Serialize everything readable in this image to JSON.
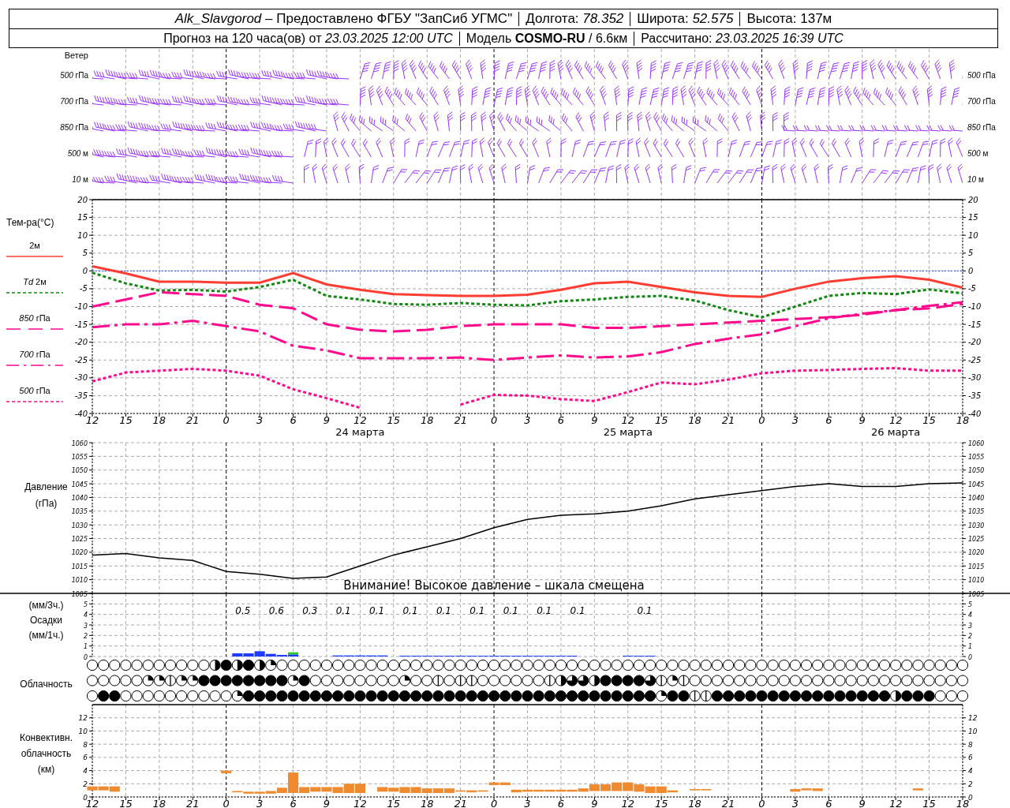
{
  "header": {
    "rows": [
      [
        "*Alk_Slavgorod* – Предоставлено ФГБУ \"ЗапСиб УГМС\"",
        "Долгота: *78.352*",
        "Широта: *52.575*",
        "Высота: 137м"
      ],
      [
        "Прогноз на 120 часа(ов) от *23.03.2025 12:00 UTC*",
        "Модель **COSMO-RU** / 6.6км",
        "Рассчитано: *23.03.2025 16:39 UTC*"
      ]
    ]
  },
  "wind": {
    "title": "Ветер",
    "left_labels": [
      "*500* гПа",
      "*700* гПа",
      "*850* гПа",
      "*500* м",
      "*10* м"
    ],
    "right_labels": [
      "*500* гПа",
      "*700* гПа",
      "*850* гПа",
      "*500* м",
      "*10* м"
    ]
  },
  "temperature": {
    "title": "Тем-ра(°C)",
    "day_labels": [
      "24 марта",
      "25 марта",
      "26 марта"
    ],
    "right_ticks": [
      "20",
      "15",
      "10",
      "5",
      "0",
      "-5",
      "-10",
      "-15",
      "-20",
      "-25",
      "-30",
      "-35",
      "-40"
    ],
    "chart_data": {
      "type": "line",
      "grid": true,
      "ref_lines": [
        {
          "axis": "y",
          "value": 0,
          "color": "#2244ff"
        }
      ],
      "categories": [
        "12",
        "15",
        "18",
        "21",
        "0",
        "3",
        "6",
        "9",
        "12",
        "15",
        "18",
        "21",
        "0",
        "3",
        "6",
        "9",
        "12",
        "15",
        "18",
        "21",
        "0",
        "3",
        "6",
        "9",
        "12",
        "15",
        "18"
      ],
      "ylim": [
        -40,
        20
      ],
      "yticks": [
        -40,
        -35,
        -30,
        -25,
        -20,
        -15,
        -10,
        -5,
        0,
        5,
        10,
        15,
        20
      ],
      "series": [
        {
          "name": "2м",
          "color": "#ff3c32",
          "line_style": "solid",
          "values": [
            1.3,
            -0.7,
            -3,
            -3,
            -3.3,
            -3.3,
            -0.6,
            -3.8,
            -5.3,
            -6.5,
            -6.8,
            -7,
            -7,
            -6.7,
            -5.3,
            -3.5,
            -3,
            -4.5,
            -6,
            -7,
            -7.3,
            -5,
            -3,
            -2,
            -1.5,
            -2.5,
            -4.7
          ]
        },
        {
          "name": "*Td* 2м",
          "color": "#118811",
          "line_style": "dotted",
          "values": [
            -0.5,
            -3.5,
            -5.5,
            -5.3,
            -5.8,
            -4.5,
            -2.5,
            -7,
            -8,
            -9.3,
            -9.5,
            -9,
            -9.5,
            -9.7,
            -8.5,
            -8,
            -7.3,
            -7,
            -8.3,
            -11,
            -13,
            -10,
            -7,
            -6.2,
            -6.5,
            -5.2,
            -6.3
          ]
        },
        {
          "name": "*850* гПа",
          "color": "#ff0a8c",
          "line_style": "dashed",
          "values": [
            -10,
            -8,
            -6,
            -6.5,
            -7,
            -9.5,
            -10.5,
            -15,
            -16.5,
            -17,
            -16.5,
            -15.5,
            -15,
            -15,
            -15,
            -16,
            -16,
            -15.5,
            -15,
            -14.5,
            -14,
            -13.5,
            -13,
            -12.3,
            -11,
            -10.5,
            -9.3
          ]
        },
        {
          "name": "*700* гПа",
          "color": "#ff0a8c",
          "line_style": "dashdot",
          "values": [
            -15.8,
            -15,
            -15,
            -14,
            -15.5,
            -17,
            -21,
            -22.3,
            -24.5,
            -24.5,
            -24.5,
            -24.3,
            -25,
            -24.3,
            -23.7,
            -24.3,
            -24,
            -22.8,
            -20.5,
            -19,
            -17.8,
            -15.5,
            -13.3,
            -12,
            -11,
            -9.8,
            -8.8
          ]
        },
        {
          "name": "*500* гПа",
          "color": "#ff0a8c",
          "line_style": "dotted",
          "values": [
            -31,
            -28.5,
            -28,
            -27.5,
            -28,
            -29.4,
            -33.2,
            -35.7,
            -38.4,
            null,
            null,
            -37.5,
            -34.8,
            -35,
            -36,
            -36.5,
            -34,
            -31.3,
            -31.8,
            -30.5,
            -28.7,
            -28,
            -27.8,
            -27.5,
            -27.3,
            -28,
            -28
          ]
        }
      ]
    }
  },
  "pressure": {
    "title": "Давление",
    "unit": "(гПа)",
    "note": "Внимание! Высокое давление – шкала смещена",
    "right_ticks": [
      "1060",
      "1055",
      "1050",
      "1045",
      "1040",
      "1035",
      "1030",
      "1025",
      "1020",
      "1015",
      "1010",
      "1005"
    ],
    "chart_data": {
      "type": "line",
      "grid": true,
      "ylim": [
        1005,
        1060
      ],
      "yticks": [
        1005,
        1010,
        1015,
        1020,
        1025,
        1030,
        1035,
        1040,
        1045,
        1050,
        1055,
        1060
      ],
      "series": [
        {
          "color": "#000000",
          "line_style": "solid",
          "values": [
            1019,
            1019.5,
            1018,
            1017,
            1013,
            1012,
            1010.5,
            1011,
            1015,
            1019,
            1022,
            1025,
            1029,
            1032,
            1033.5,
            1034,
            1035,
            1037,
            1039.5,
            1041,
            1042.5,
            1044,
            1045,
            1044,
            1044,
            1045,
            1045.3
          ]
        }
      ]
    }
  },
  "precipitation": {
    "labels": [
      "(мм/3ч.)",
      "Осадки",
      "(мм/1ч.)"
    ],
    "right_ticks": [
      "5",
      "4",
      "3",
      "2",
      "1",
      "0"
    ],
    "period_totals": [
      {
        "label": "0.5",
        "gap_before": false
      },
      {
        "label": "0.6",
        "gap_before": false
      },
      {
        "label": "0.3",
        "gap_before": false
      },
      {
        "label": "0.1",
        "gap_before": false
      },
      {
        "label": "0.1",
        "gap_before": false
      },
      {
        "label": "0.1",
        "gap_before": false
      },
      {
        "label": "0.1",
        "gap_before": false
      },
      {
        "label": "0.1",
        "gap_before": false
      },
      {
        "label": "0.1",
        "gap_before": false
      },
      {
        "label": "0.1",
        "gap_before": false
      },
      {
        "label": "0.1",
        "gap_before": false
      },
      {
        "label": "0.1",
        "gap_before": true
      }
    ],
    "chart_data": {
      "type": "bar",
      "grid": true,
      "stacked": true,
      "ylim": [
        0,
        6
      ],
      "yticks": [
        0,
        1,
        2,
        3,
        4,
        5
      ],
      "series": [
        {
          "color": "#1e3cff",
          "values": [
            null,
            null,
            null,
            null,
            null,
            null,
            null,
            null,
            null,
            null,
            null,
            null,
            null,
            0.3,
            0.3,
            0.5,
            0.25,
            0.15,
            0.2,
            null,
            null,
            null,
            0.1,
            0.1,
            0.1,
            0.1,
            0.1,
            null,
            0.05,
            0.05,
            0.05,
            0.05,
            0.05,
            0.05,
            0.05,
            0.05,
            0.05,
            0.05,
            0.05,
            0.05,
            0.05,
            0.05,
            0.05,
            0.05,
            null,
            null,
            null,
            null,
            0.05,
            0.05,
            0.05,
            null,
            null,
            null,
            null,
            null,
            null,
            null,
            null,
            null,
            null,
            null,
            null,
            null,
            null,
            null,
            null,
            null,
            null,
            null,
            null,
            null,
            null,
            null,
            null,
            null,
            null,
            null,
            null
          ]
        },
        {
          "color": "#22cc22",
          "values": [
            null,
            null,
            null,
            null,
            null,
            null,
            null,
            null,
            null,
            null,
            null,
            null,
            null,
            null,
            null,
            null,
            null,
            null,
            0.2,
            null,
            null,
            null,
            null,
            null,
            null,
            null,
            null,
            null,
            null,
            null,
            null,
            null,
            null,
            null,
            null,
            null,
            null,
            null,
            null,
            null,
            null,
            null,
            null,
            null,
            null,
            null,
            null,
            null,
            null,
            null,
            null,
            null,
            null,
            null,
            null,
            null,
            null,
            null,
            null,
            null,
            null,
            null,
            null,
            null,
            null,
            null,
            null,
            null,
            null,
            null,
            null,
            null,
            null,
            null,
            null,
            null,
            null,
            null,
            null
          ]
        }
      ]
    }
  },
  "clouds": {
    "title": "Облачность",
    "rows": [
      {
        "cells": [
          {
            "kind": "clear"
          },
          {
            "kind": "clear"
          },
          {
            "kind": "clear"
          },
          {
            "kind": "clear"
          },
          {
            "kind": "clear"
          },
          {
            "kind": "clear"
          },
          {
            "kind": "clear"
          },
          {
            "kind": "clear"
          },
          {
            "kind": "clear"
          },
          {
            "kind": "clear"
          },
          {
            "kind": "clear"
          },
          {
            "kind": "half"
          },
          {
            "kind": "full"
          },
          {
            "kind": "half"
          },
          {
            "kind": "full"
          },
          {
            "kind": "half"
          },
          {
            "kind": "quarter"
          },
          {
            "kind": "clear"
          },
          {
            "kind": "clear"
          },
          {
            "kind": "clear"
          },
          {
            "kind": "clear"
          },
          {
            "kind": "clear"
          },
          {
            "kind": "clear"
          },
          {
            "kind": "clear"
          },
          {
            "kind": "clear"
          },
          {
            "kind": "clear"
          },
          {
            "kind": "clear"
          },
          {
            "kind": "clear"
          },
          {
            "kind": "clear"
          },
          {
            "kind": "clear"
          },
          {
            "kind": "clear"
          },
          {
            "kind": "clear"
          },
          {
            "kind": "clear"
          },
          {
            "kind": "clear"
          },
          {
            "kind": "clear"
          },
          {
            "kind": "clear"
          },
          {
            "kind": "clear"
          },
          {
            "kind": "clear"
          },
          {
            "kind": "clear"
          },
          {
            "kind": "clear"
          },
          {
            "kind": "clear"
          },
          {
            "kind": "clear"
          },
          {
            "kind": "clear"
          },
          {
            "kind": "clear"
          },
          {
            "kind": "clear"
          },
          {
            "kind": "clear"
          },
          {
            "kind": "clear"
          },
          {
            "kind": "clear"
          },
          {
            "kind": "clear"
          },
          {
            "kind": "clear"
          },
          {
            "kind": "clear"
          },
          {
            "kind": "clear"
          },
          {
            "kind": "clear"
          },
          {
            "kind": "clear"
          },
          {
            "kind": "clear"
          },
          {
            "kind": "clear"
          },
          {
            "kind": "clear"
          },
          {
            "kind": "clear"
          },
          {
            "kind": "clear"
          },
          {
            "kind": "clear"
          },
          {
            "kind": "clear"
          },
          {
            "kind": "clear"
          },
          {
            "kind": "clear"
          },
          {
            "kind": "clear"
          },
          {
            "kind": "clear"
          },
          {
            "kind": "clear"
          },
          {
            "kind": "clear"
          },
          {
            "kind": "clear"
          },
          {
            "kind": "clear"
          },
          {
            "kind": "clear"
          },
          {
            "kind": "clear"
          },
          {
            "kind": "clear"
          },
          {
            "kind": "clear"
          },
          {
            "kind": "clear"
          },
          {
            "kind": "clear"
          },
          {
            "kind": "clear"
          },
          {
            "kind": "clear"
          },
          {
            "kind": "clear"
          },
          {
            "kind": "clear"
          }
        ]
      },
      {
        "cells": [
          {
            "kind": "clear"
          },
          {
            "kind": "clear"
          },
          {
            "kind": "clear"
          },
          {
            "kind": "clear"
          },
          {
            "kind": "clear"
          },
          {
            "kind": "quarter"
          },
          {
            "kind": "quarter"
          },
          {
            "kind": "line"
          },
          {
            "kind": "quarter"
          },
          {
            "kind": "quarter"
          },
          {
            "kind": "full"
          },
          {
            "kind": "full"
          },
          {
            "kind": "full"
          },
          {
            "kind": "full"
          },
          {
            "kind": "full"
          },
          {
            "kind": "full"
          },
          {
            "kind": "full"
          },
          {
            "kind": "full"
          },
          {
            "kind": "quarter"
          },
          {
            "kind": "full"
          },
          {
            "kind": "clear"
          },
          {
            "kind": "clear"
          },
          {
            "kind": "clear"
          },
          {
            "kind": "clear"
          },
          {
            "kind": "clear"
          },
          {
            "kind": "clear"
          },
          {
            "kind": "clear"
          },
          {
            "kind": "clear"
          },
          {
            "kind": "quarter"
          },
          {
            "kind": "clear"
          },
          {
            "kind": "clear"
          },
          {
            "kind": "line"
          },
          {
            "kind": "clear"
          },
          {
            "kind": "line"
          },
          {
            "kind": "line"
          },
          {
            "kind": "clear"
          },
          {
            "kind": "clear"
          },
          {
            "kind": "clear"
          },
          {
            "kind": "clear"
          },
          {
            "kind": "clear"
          },
          {
            "kind": "clear"
          },
          {
            "kind": "line"
          },
          {
            "kind": "half"
          },
          {
            "kind": "three_quarter"
          },
          {
            "kind": "three_quarter"
          },
          {
            "kind": "half"
          },
          {
            "kind": "full"
          },
          {
            "kind": "full"
          },
          {
            "kind": "full"
          },
          {
            "kind": "full"
          },
          {
            "kind": "three_quarter"
          },
          {
            "kind": "line"
          },
          {
            "kind": "quarter"
          },
          {
            "kind": "line"
          },
          {
            "kind": "clear"
          },
          {
            "kind": "clear"
          },
          {
            "kind": "clear"
          },
          {
            "kind": "clear"
          },
          {
            "kind": "clear"
          },
          {
            "kind": "clear"
          },
          {
            "kind": "clear"
          },
          {
            "kind": "clear"
          },
          {
            "kind": "clear"
          },
          {
            "kind": "clear"
          },
          {
            "kind": "clear"
          },
          {
            "kind": "clear"
          },
          {
            "kind": "clear"
          },
          {
            "kind": "clear"
          },
          {
            "kind": "clear"
          },
          {
            "kind": "clear"
          },
          {
            "kind": "clear"
          },
          {
            "kind": "clear"
          },
          {
            "kind": "clear"
          },
          {
            "kind": "clear"
          },
          {
            "kind": "clear"
          },
          {
            "kind": "clear"
          },
          {
            "kind": "clear"
          },
          {
            "kind": "clear"
          },
          {
            "kind": "clear"
          }
        ]
      },
      {
        "cells": [
          {
            "kind": "clear"
          },
          {
            "kind": "full"
          },
          {
            "kind": "full"
          },
          {
            "kind": "clear"
          },
          {
            "kind": "clear"
          },
          {
            "kind": "clear"
          },
          {
            "kind": "clear"
          },
          {
            "kind": "clear"
          },
          {
            "kind": "clear"
          },
          {
            "kind": "clear"
          },
          {
            "kind": "clear"
          },
          {
            "kind": "clear"
          },
          {
            "kind": "clear"
          },
          {
            "kind": "quarter"
          },
          {
            "kind": "full"
          },
          {
            "kind": "full"
          },
          {
            "kind": "full"
          },
          {
            "kind": "full"
          },
          {
            "kind": "full"
          },
          {
            "kind": "full"
          },
          {
            "kind": "full"
          },
          {
            "kind": "full"
          },
          {
            "kind": "full"
          },
          {
            "kind": "full"
          },
          {
            "kind": "full"
          },
          {
            "kind": "full"
          },
          {
            "kind": "full"
          },
          {
            "kind": "full"
          },
          {
            "kind": "full"
          },
          {
            "kind": "full"
          },
          {
            "kind": "full"
          },
          {
            "kind": "full"
          },
          {
            "kind": "full"
          },
          {
            "kind": "full"
          },
          {
            "kind": "full"
          },
          {
            "kind": "full"
          },
          {
            "kind": "full"
          },
          {
            "kind": "full"
          },
          {
            "kind": "full"
          },
          {
            "kind": "full"
          },
          {
            "kind": "full"
          },
          {
            "kind": "full"
          },
          {
            "kind": "full"
          },
          {
            "kind": "full"
          },
          {
            "kind": "full"
          },
          {
            "kind": "full"
          },
          {
            "kind": "full"
          },
          {
            "kind": "full"
          },
          {
            "kind": "full"
          },
          {
            "kind": "full"
          },
          {
            "kind": "full"
          },
          {
            "kind": "quarter"
          },
          {
            "kind": "full"
          },
          {
            "kind": "full"
          },
          {
            "kind": "line"
          },
          {
            "kind": "line"
          },
          {
            "kind": "full"
          },
          {
            "kind": "full"
          },
          {
            "kind": "full"
          },
          {
            "kind": "full"
          },
          {
            "kind": "full"
          },
          {
            "kind": "full"
          },
          {
            "kind": "full"
          },
          {
            "kind": "full"
          },
          {
            "kind": "full"
          },
          {
            "kind": "full"
          },
          {
            "kind": "full"
          },
          {
            "kind": "full"
          },
          {
            "kind": "full"
          },
          {
            "kind": "full"
          },
          {
            "kind": "full"
          },
          {
            "kind": "full"
          },
          {
            "kind": "half"
          },
          {
            "kind": "full"
          },
          {
            "kind": "full"
          },
          {
            "kind": "full"
          },
          {
            "kind": "clear"
          },
          {
            "kind": "clear"
          },
          {
            "kind": "clear"
          }
        ]
      }
    ]
  },
  "convective": {
    "labels": [
      "Конвективн.",
      "облачность",
      "(км)"
    ],
    "right_ticks": [
      "12",
      "10",
      "8",
      "6",
      "4",
      "2",
      "0"
    ],
    "chart_data": {
      "type": "bar",
      "grid": true,
      "ylim": [
        0,
        14
      ],
      "yticks": [
        0,
        2,
        4,
        6,
        8,
        10,
        12
      ],
      "categories": [
        "12",
        null,
        null,
        "15",
        null,
        null,
        "18",
        null,
        null,
        "21",
        null,
        null,
        "0",
        null,
        null,
        "3",
        null,
        null,
        "6",
        null,
        null,
        "9",
        null,
        null,
        "12",
        null,
        null,
        "15",
        null,
        null,
        "18",
        null,
        null,
        "21",
        null,
        null,
        "0",
        null,
        null,
        "3",
        null,
        null,
        "6",
        null,
        null,
        "9",
        null,
        null,
        "12",
        null,
        null,
        "15",
        null,
        null,
        "18",
        null,
        null,
        "21",
        null,
        null,
        "0",
        null,
        null,
        "3",
        null,
        null,
        "6",
        null,
        null,
        "9",
        null,
        null,
        "12",
        null,
        null,
        "15",
        null,
        null,
        "18"
      ],
      "series": [
        {
          "color": "#f08a2e",
          "values": [
            0.6,
            0.6,
            0.8,
            null,
            null,
            null,
            null,
            null,
            null,
            null,
            null,
            null,
            0.4,
            0.2,
            0.3,
            0.3,
            0.4,
            0.8,
            3.1,
            0.9,
            0.7,
            0.7,
            0.9,
            1.4,
            1.4,
            null,
            0.7,
            0.6,
            0.9,
            0.9,
            0.7,
            0.7,
            0.7,
            0.2,
            0.3,
            0.2,
            0.4,
            0.4,
            0.4,
            0.3,
            0.3,
            0.3,
            0.3,
            0.3,
            0.5,
            1.0,
            1.0,
            1.3,
            1.3,
            1.1,
            1.0,
            1.0,
            0.3,
            null,
            0.2,
            0.2,
            null,
            null,
            null,
            null,
            null,
            null,
            null,
            0.4,
            0.3,
            0.4,
            null,
            null,
            null,
            null,
            null,
            null,
            null,
            null,
            0.3,
            null,
            null,
            null,
            null
          ],
          "base": [
            1.0,
            1.0,
            0.8,
            null,
            null,
            null,
            null,
            null,
            null,
            null,
            null,
            null,
            3.6,
            0.7,
            0.5,
            0.5,
            0.5,
            0.6,
            0.6,
            0.6,
            0.8,
            0.8,
            0.6,
            0.6,
            0.6,
            null,
            0.8,
            0.8,
            0.6,
            0.6,
            0.6,
            0.6,
            0.6,
            0.8,
            0.7,
            0.8,
            1.8,
            1.8,
            0.7,
            0.8,
            0.8,
            0.8,
            0.8,
            0.8,
            0.8,
            0.9,
            0.9,
            0.9,
            0.9,
            0.8,
            0.6,
            0.6,
            0.7,
            null,
            1.0,
            1.0,
            null,
            null,
            null,
            null,
            null,
            null,
            null,
            0.8,
            1.0,
            0.9,
            null,
            null,
            null,
            null,
            null,
            null,
            null,
            null,
            1.0,
            null,
            null,
            null,
            null
          ]
        }
      ]
    }
  }
}
